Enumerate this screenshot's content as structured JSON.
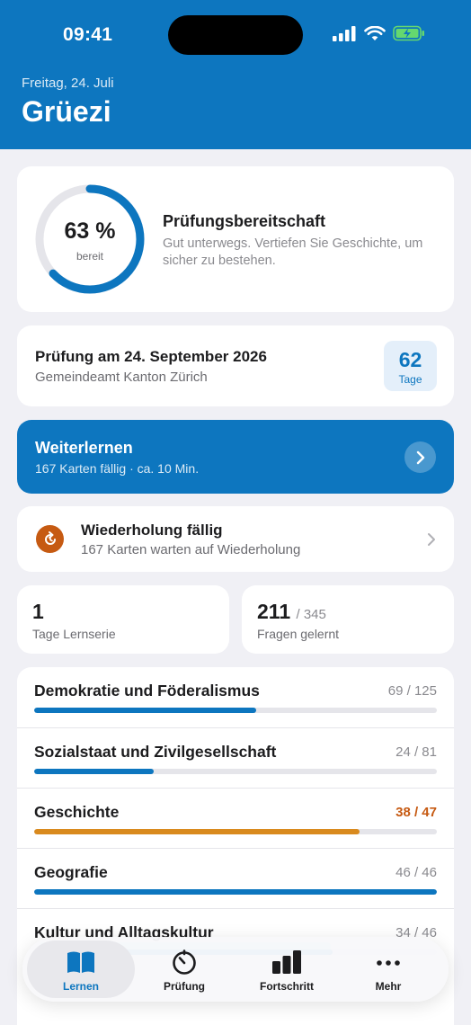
{
  "status_bar": {
    "time": "09:41"
  },
  "header": {
    "date": "Freitag, 24. Juli",
    "greeting": "Grüezi"
  },
  "readiness": {
    "percent_label": "63 %",
    "percent_value": 63,
    "sub_label": "bereit",
    "title": "Prüfungsbereitschaft",
    "description": "Gut unterwegs. Vertiefen Sie Geschichte, um sicher zu bestehen."
  },
  "exam": {
    "title": "Prüfung am 24. September 2026",
    "place": "Gemeindeamt Kanton Zürich",
    "days": "62",
    "days_label": "Tage"
  },
  "continue": {
    "title": "Weiterlernen",
    "subtitle": "167 Karten fällig · ca. 10 Min.",
    "icon": "chevron-right-icon"
  },
  "review": {
    "title": "Wiederholung fällig",
    "subtitle": "167 Karten warten auf Wiederholung",
    "icon": "refresh-icon"
  },
  "stats": {
    "streak": {
      "value": "1",
      "label": "Tage Lernserie"
    },
    "learned": {
      "value": "211",
      "total": "/ 345",
      "label": "Fragen gelernt"
    }
  },
  "topics": [
    {
      "name": "Demokratie und Föderalismus",
      "count": "69 / 125",
      "progress": 0.552,
      "color": "#0d76bf",
      "warn": false
    },
    {
      "name": "Sozialstaat und Zivilgesellschaft",
      "count": "24 / 81",
      "progress": 0.296,
      "color": "#0d76bf",
      "warn": false
    },
    {
      "name": "Geschichte",
      "count": "38 / 47",
      "progress": 0.809,
      "color": "#d98a1e",
      "warn": true
    },
    {
      "name": "Geografie",
      "count": "46 / 46",
      "progress": 1.0,
      "color": "#0d76bf",
      "warn": false
    },
    {
      "name": "Kultur und Alltagskultur",
      "count": "34 / 46",
      "progress": 0.74,
      "color": "#0d76bf",
      "warn": false
    }
  ],
  "tabs": [
    {
      "label": "Lernen",
      "icon": "book-icon",
      "active": true
    },
    {
      "label": "Prüfung",
      "icon": "timer-icon",
      "active": false
    },
    {
      "label": "Fortschritt",
      "icon": "bar-chart-icon",
      "active": false
    },
    {
      "label": "Mehr",
      "icon": "more-icon",
      "active": false
    }
  ],
  "colors": {
    "primary": "#0d76bf",
    "warning": "#c65a12",
    "background": "#f0f0f5"
  }
}
